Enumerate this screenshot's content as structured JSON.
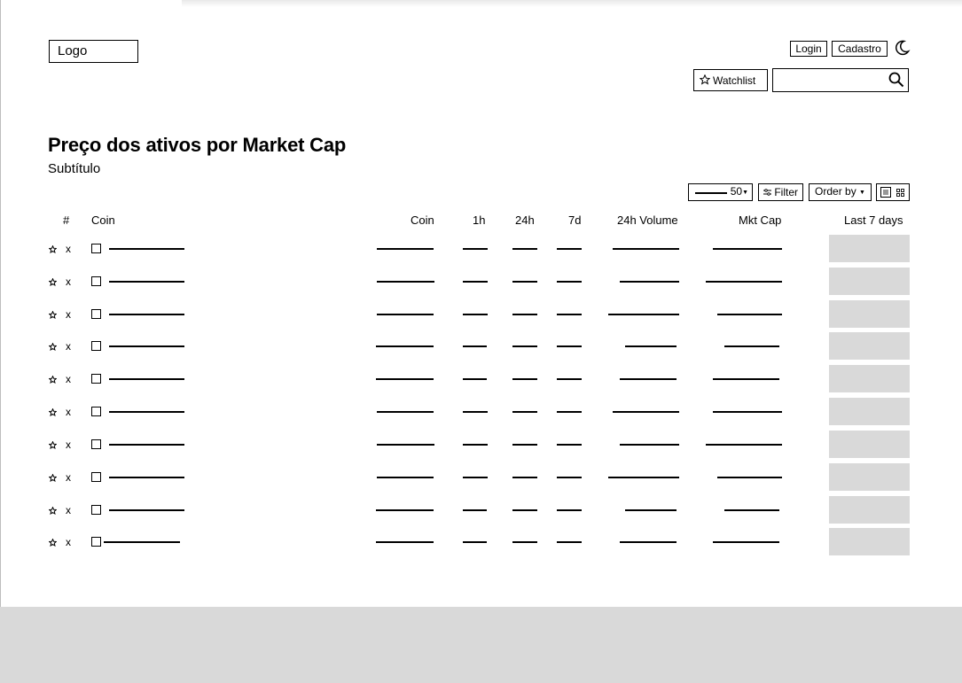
{
  "header": {
    "logo_text": "Logo",
    "login_label": "Login",
    "signup_label": "Cadastro",
    "theme_icon": "moon-icon",
    "watchlist_label": "Watchlist",
    "watchlist_icon": "star-icon",
    "search_value": "",
    "search_icon": "search-icon"
  },
  "main": {
    "title": "Preço dos ativos por Market Cap",
    "subtitle": "Subtítulo"
  },
  "toolbar": {
    "rows_value": "50",
    "filter_label": "Filter",
    "order_label": "Order by",
    "view_icons": [
      "list-icon",
      "grid-icon"
    ]
  },
  "table": {
    "columns": [
      "#",
      "Coin",
      "Coin",
      "1h",
      "24h",
      "7d",
      "24h Volume",
      "Mkt Cap",
      "Last 7 days"
    ],
    "rows": [
      {
        "rank_marker": "x"
      },
      {
        "rank_marker": "x"
      },
      {
        "rank_marker": "x"
      },
      {
        "rank_marker": "x"
      },
      {
        "rank_marker": "x"
      },
      {
        "rank_marker": "x"
      },
      {
        "rank_marker": "x"
      },
      {
        "rank_marker": "x"
      },
      {
        "rank_marker": "x"
      },
      {
        "rank_marker": "x"
      }
    ]
  },
  "colors": {
    "sparkline_placeholder": "#d9d9d9",
    "footer": "#d9d9d9"
  }
}
